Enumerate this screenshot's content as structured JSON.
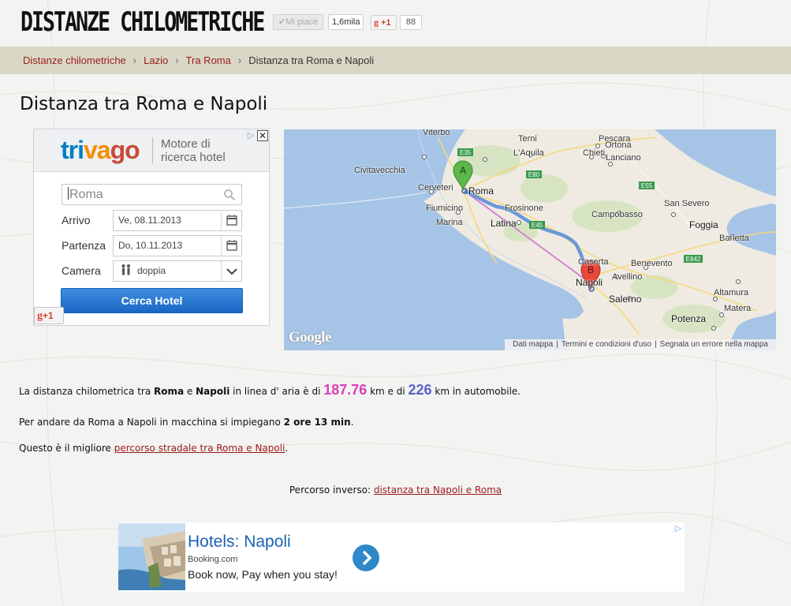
{
  "header": {
    "logo": "DISTANZE CHILOMETRICHE",
    "fb_like_label": "✔Mi piace",
    "fb_like_count": "1,6mila",
    "gplus_label": "+1",
    "gplus_count": "88"
  },
  "breadcrumb": {
    "items": [
      "Distanze chilometriche",
      "Lazio",
      "Tra Roma"
    ],
    "current": "Distanza tra Roma e Napoli",
    "separator": "›"
  },
  "page": {
    "title": "Distanza tra Roma e Napoli"
  },
  "trivago": {
    "logo_parts": [
      "tri",
      "va",
      "go"
    ],
    "tagline": "Motore di ricerca hotel",
    "close": "✕",
    "adchoice": "▷",
    "search_value": "Roma",
    "arrival_label": "Arrivo",
    "arrival_value": "Ve,  08.11.2013",
    "departure_label": "Partenza",
    "departure_value": "Do,  10.11.2013",
    "room_label": "Camera",
    "room_value": "doppia",
    "button_label": "Cerca Hotel",
    "gplus_label": "+1",
    "colors": {
      "blue": "#007fc3",
      "orange": "#f48f00",
      "red": "#c94a38",
      "button": "#1b66c4"
    }
  },
  "map": {
    "labels": {
      "viterbo": "Viterbo",
      "terni": "Terni",
      "laquila": "L'Aquila",
      "pescara": "Pescara",
      "civitavecchia": "Civitavecchia",
      "cerveteri": "Cerveteri",
      "roma": "Roma",
      "chieti": "Chieti",
      "ortona": "Ortona",
      "lanciano": "Lanciano",
      "fiumicino": "Fiumicino",
      "frosinone": "Frosinone",
      "marina": "Marina",
      "latina": "Latina",
      "san_severo": "San Severo",
      "campobasso": "Campobasso",
      "foggia": "Foggia",
      "barletta": "Barletta",
      "caserta": "Caserta",
      "benevento": "Benevento",
      "napoli": "Napoli",
      "avellino": "Avellino",
      "salerno": "Salerno",
      "altamura": "Altamura",
      "matera": "Matera",
      "potenza": "Potenza"
    },
    "roads": {
      "e35": "E35",
      "e80": "E80",
      "e55": "E55",
      "e45": "E45",
      "e842": "E842"
    },
    "marker_a": "A",
    "marker_b": "B",
    "google": "Google",
    "footer": [
      "Dati mappa",
      "Termini e condizioni d'uso",
      "Segnala un errore nella mappa"
    ],
    "colors": {
      "sea": "#a6c4e6",
      "land": "#efebe2",
      "route": "#5b8fd8",
      "airline": "#d87ad2",
      "marker_a": "#5cb84a",
      "marker_b": "#e8473b"
    }
  },
  "content": {
    "line1_pre": "La distanza chilometrica tra ",
    "city_a": "Roma",
    "line1_and": " e ",
    "city_b": "Napoli",
    "line1_mid": " in linea d' aria è di ",
    "air_km": "187.76",
    "line1_mid2": " km e di ",
    "road_km": "226",
    "line1_post": " km in automobile.",
    "line2_pre": "Per andare da Roma a Napoli in macchina si impiegano ",
    "duration": "2 ore 13 min",
    "line2_post": ".",
    "line3_pre": "Questo è il migliore ",
    "route_link": "percorso stradale tra Roma e Napoli",
    "line3_post": ".",
    "reverse_label": "Percorso inverso: ",
    "reverse_link": "distanza tra Napoli e Roma"
  },
  "ad": {
    "title": "Hotels: Napoli",
    "source": "Booking.com",
    "description": "Book now, Pay when you stay!",
    "adchoice": "▷"
  }
}
